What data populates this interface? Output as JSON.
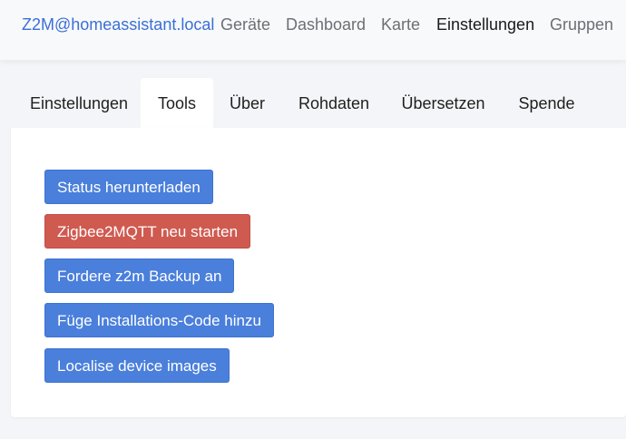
{
  "header": {
    "brand": "Z2M@homeassistant.local",
    "nav": [
      {
        "label": "Geräte"
      },
      {
        "label": "Dashboard"
      },
      {
        "label": "Karte"
      },
      {
        "label": "Einstellungen",
        "active": true
      },
      {
        "label": "Gruppen"
      }
    ]
  },
  "tabs": [
    {
      "label": "Einstellungen"
    },
    {
      "label": "Tools",
      "active": true
    },
    {
      "label": "Über"
    },
    {
      "label": "Rohdaten"
    },
    {
      "label": "Übersetzen"
    },
    {
      "label": "Spende"
    }
  ],
  "tools": {
    "buttons": [
      {
        "label": "Status herunterladen",
        "variant": "primary"
      },
      {
        "label": "Zigbee2MQTT neu starten",
        "variant": "danger"
      },
      {
        "label": "Fordere z2m Backup an",
        "variant": "primary"
      },
      {
        "label": "Füge Installations-Code hinzu",
        "variant": "primary"
      },
      {
        "label": "Localise device images",
        "variant": "primary"
      }
    ]
  },
  "colors": {
    "brand": "#3a6fd6",
    "primary": "#4a7fdb",
    "danger": "#cf5a50"
  }
}
